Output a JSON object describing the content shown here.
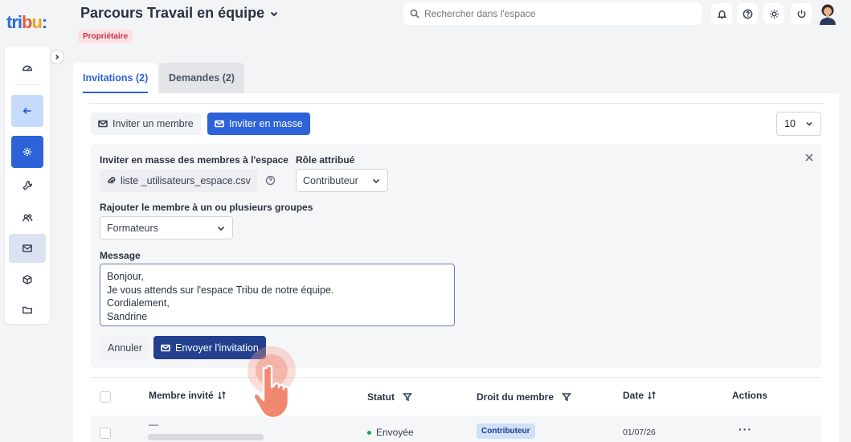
{
  "app": {
    "logo": "tribu"
  },
  "header": {
    "title": "Parcours Travail en équipe",
    "owner_badge": "Propriétaire",
    "search_placeholder": "Rechercher dans l'espace"
  },
  "tabs": [
    {
      "label": "Invitations (2)",
      "active": true
    },
    {
      "label": "Demandes (2)",
      "active": false
    }
  ],
  "toolbar": {
    "invite_member": "Inviter un membre",
    "invite_bulk": "Inviter en masse",
    "page_size": "10"
  },
  "bulk_invite": {
    "file_label": "Inviter en masse des membres à l'espace",
    "file_name": "liste _utilisateurs_espace.csv",
    "role_label": "Rôle attribué",
    "role_value": "Contributeur",
    "group_label": "Rajouter le membre à un ou plusieurs groupes",
    "group_value": "Formateurs",
    "message_label": "Message",
    "message_lines": [
      "Bonjour,",
      "Je vous attends sur l'espace Tribu de notre équipe.",
      "Cordialement,",
      "Sandrine"
    ],
    "cancel_label": "Annuler",
    "send_label": "Envoyer l'invitation"
  },
  "table": {
    "columns": {
      "member": "Membre invité",
      "status": "Statut",
      "role": "Droit du membre",
      "date": "Date",
      "actions": "Actions"
    },
    "rows": [
      {
        "member_name": "—",
        "status": "Envoyée",
        "role": "Contributeur",
        "date": "01/07/26",
        "actions": "···"
      }
    ]
  },
  "colors": {
    "primary": "#2d63d8",
    "dark_primary": "#23408e",
    "owner_badge_bg": "#fde2e4",
    "status_sent": "#22a35a"
  }
}
